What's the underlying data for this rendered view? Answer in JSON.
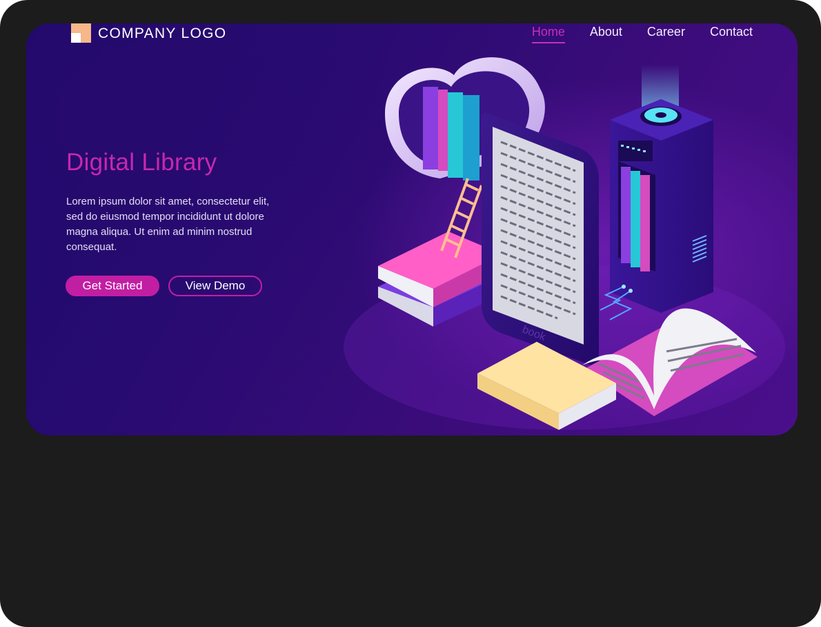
{
  "header": {
    "logo_text": "COMPANY LOGO",
    "nav": [
      {
        "label": "Home",
        "active": true
      },
      {
        "label": "About",
        "active": false
      },
      {
        "label": "Career",
        "active": false
      },
      {
        "label": "Contact",
        "active": false
      }
    ]
  },
  "hero": {
    "title": "Digital Library",
    "description": "Lorem ipsum dolor sit amet, consectetur elit, sed do eiusmod tempor incididunt ut dolore magna aliqua. Ut enim ad minim nostrud consequat.",
    "primary_button": "Get Started",
    "secondary_button": "View Demo"
  },
  "illustration": {
    "ereader_brand": "book"
  },
  "colors": {
    "accent": "#c62fb6",
    "background_dark": "#1c1c1c",
    "hero_start": "#1d0a6b",
    "hero_end": "#4a0f8c",
    "logo_orange": "#f6b88a"
  },
  "icons": [
    "logo-mark-icon",
    "cloud-icon",
    "ladder-icon",
    "ereader-icon",
    "server-icon",
    "fan-icon",
    "open-book-icon",
    "closed-book-icon"
  ]
}
